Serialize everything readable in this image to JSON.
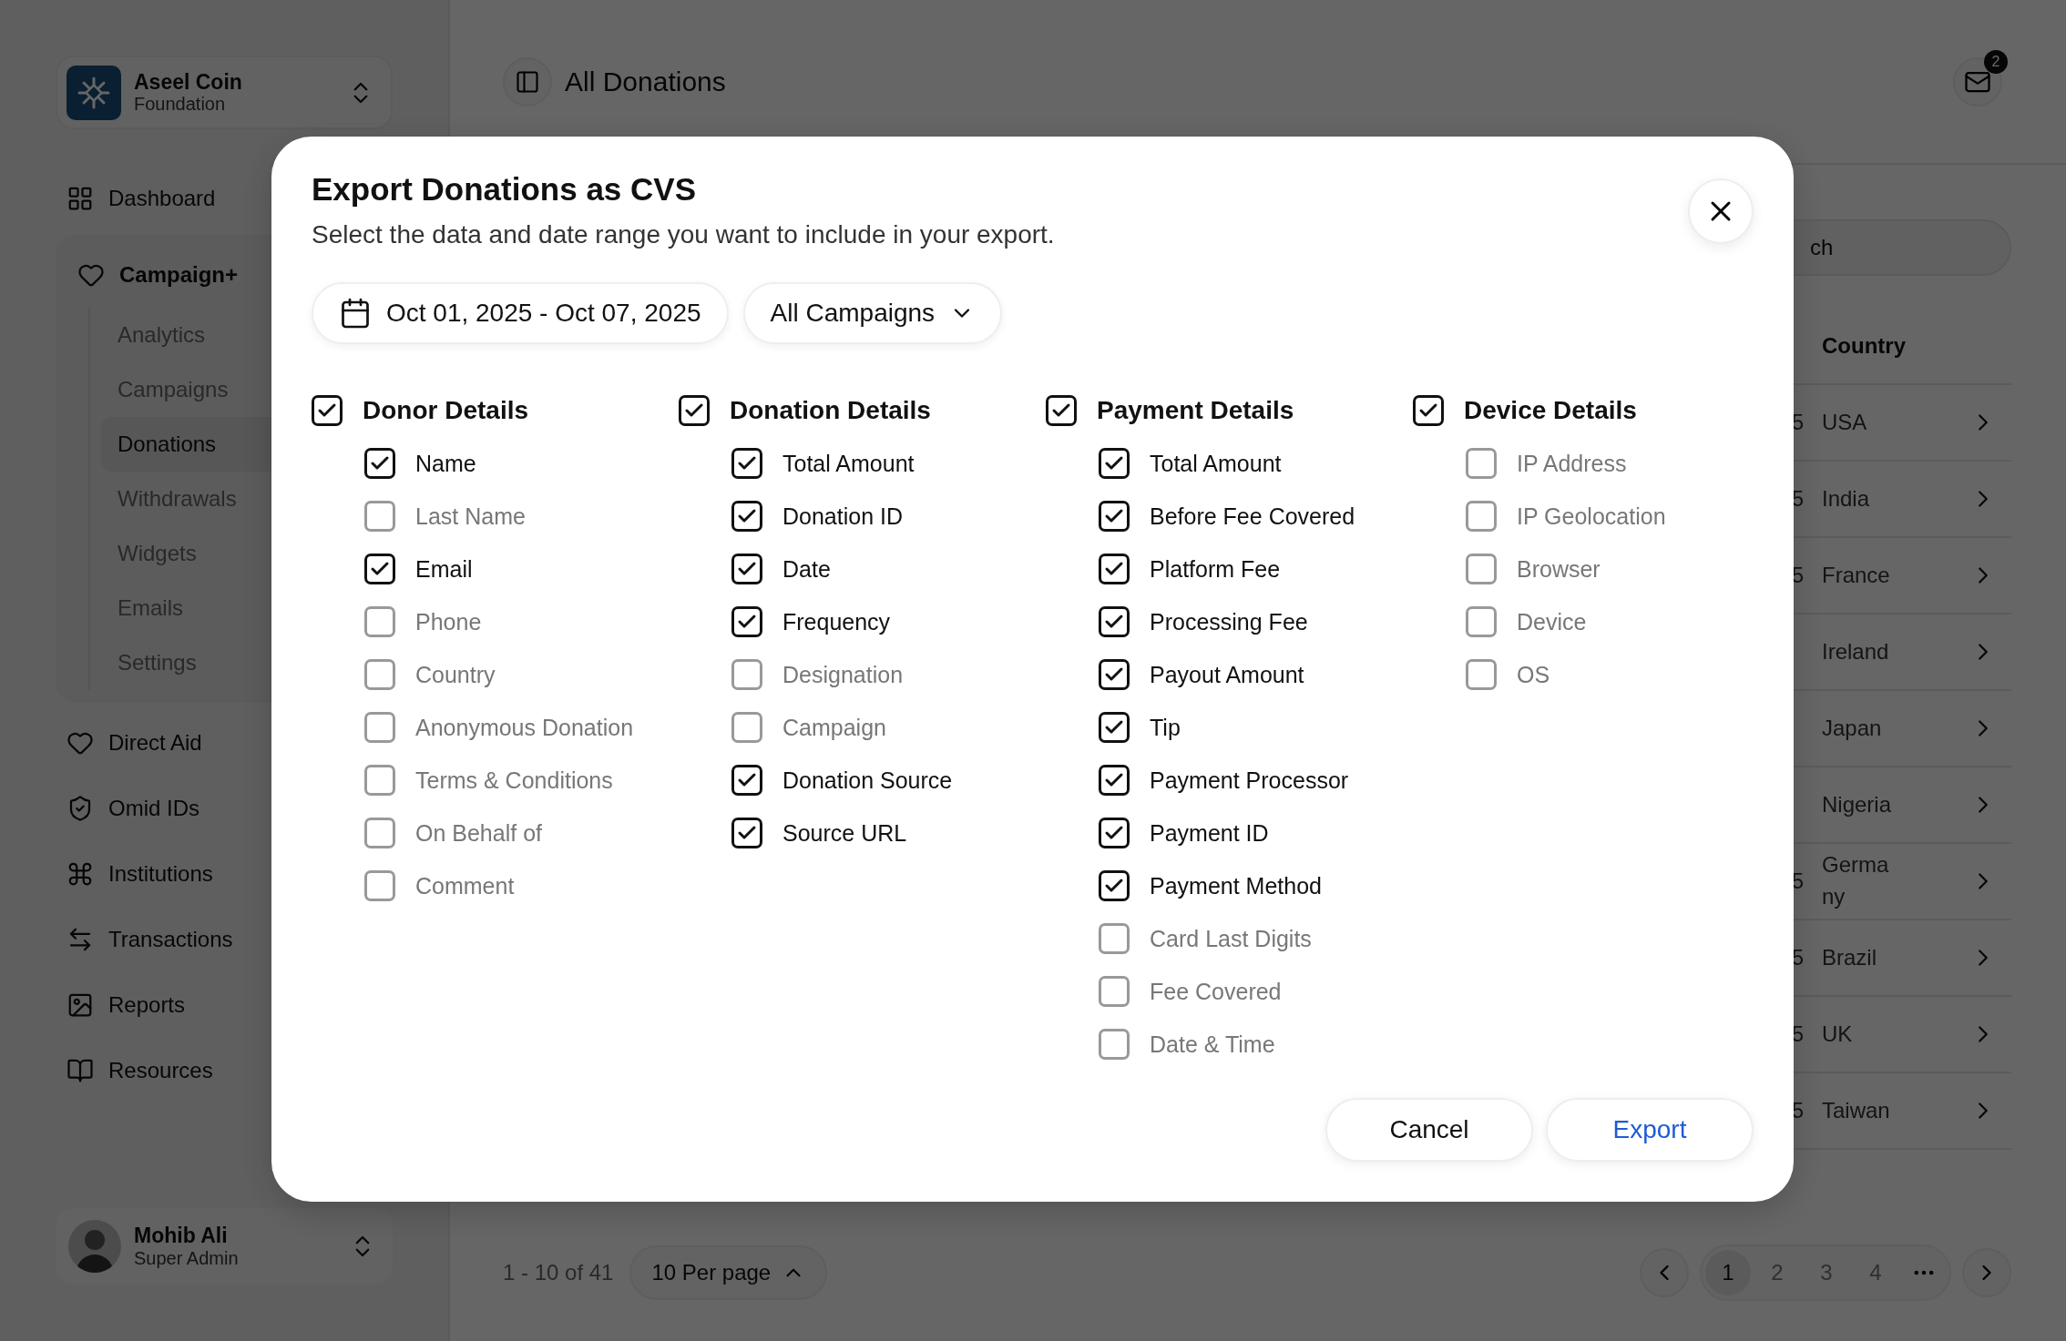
{
  "sidebar": {
    "org": {
      "name": "Aseel Coin",
      "subtitle": "Foundation"
    },
    "nav": [
      {
        "label": "Dashboard"
      },
      {
        "label": "Campaign+",
        "expanded": true,
        "children": [
          {
            "label": "Analytics",
            "selected": false
          },
          {
            "label": "Campaigns",
            "selected": false
          },
          {
            "label": "Donations",
            "selected": true
          },
          {
            "label": "Withdrawals",
            "selected": false
          },
          {
            "label": "Widgets",
            "selected": false
          },
          {
            "label": "Emails",
            "selected": false
          },
          {
            "label": "Settings",
            "selected": false
          }
        ]
      },
      {
        "label": "Direct Aid"
      },
      {
        "label": "Omid IDs"
      },
      {
        "label": "Institutions"
      },
      {
        "label": "Transactions"
      },
      {
        "label": "Reports"
      },
      {
        "label": "Resources"
      }
    ],
    "user": {
      "name": "Mohib Ali",
      "role": "Super Admin"
    }
  },
  "header": {
    "title": "All Donations",
    "notifications": "2"
  },
  "search": {
    "placeholder": "ch"
  },
  "table": {
    "columns": [
      {
        "label": "Country"
      }
    ],
    "rows": [
      {
        "column_1": "5",
        "country": "USA"
      },
      {
        "column_1": "5",
        "country": "India"
      },
      {
        "column_1": "5",
        "country": "France"
      },
      {
        "country": "Ireland"
      },
      {
        "country": "Japan"
      },
      {
        "country": "Nigeria"
      },
      {
        "column_1": "5",
        "country": "Germany"
      },
      {
        "column_1": "5",
        "country": "Brazil"
      },
      {
        "column_1": "5",
        "country": "UK"
      },
      {
        "column_1": "5",
        "country": "Taiwan"
      }
    ]
  },
  "pagination": {
    "range": "1 - 10 of 41",
    "per_page": "10 Per page",
    "pages": [
      {
        "label": "1",
        "selected": true
      },
      {
        "label": "2",
        "selected": false
      },
      {
        "label": "3",
        "selected": false
      },
      {
        "label": "4",
        "selected": false
      }
    ]
  },
  "modal": {
    "title": "Export Donations as CVS",
    "subtitle": "Select the data and date range you want to include in your export.",
    "date_range": "Oct 01, 2025 - Oct 07, 2025",
    "campaign_filter": "All Campaigns",
    "groups": [
      {
        "label": "Donor Details",
        "checked": true,
        "items": [
          {
            "label": "Name",
            "checked": true
          },
          {
            "label": "Last Name",
            "checked": false
          },
          {
            "label": "Email",
            "checked": true
          },
          {
            "label": "Phone",
            "checked": false
          },
          {
            "label": "Country",
            "checked": false
          },
          {
            "label": "Anonymous Donation",
            "checked": false
          },
          {
            "label": "Terms & Conditions",
            "checked": false
          },
          {
            "label": "On Behalf of",
            "checked": false
          },
          {
            "label": "Comment",
            "checked": false
          }
        ]
      },
      {
        "label": "Donation Details",
        "checked": true,
        "items": [
          {
            "label": "Total Amount",
            "checked": true
          },
          {
            "label": "Donation ID",
            "checked": true
          },
          {
            "label": "Date",
            "checked": true
          },
          {
            "label": "Frequency",
            "checked": true
          },
          {
            "label": "Designation",
            "checked": false
          },
          {
            "label": "Campaign",
            "checked": false
          },
          {
            "label": "Donation Source",
            "checked": true
          },
          {
            "label": "Source URL",
            "checked": true
          }
        ]
      },
      {
        "label": "Payment Details",
        "checked": true,
        "items": [
          {
            "label": "Total Amount",
            "checked": true
          },
          {
            "label": "Before Fee Covered",
            "checked": true
          },
          {
            "label": "Platform Fee",
            "checked": true
          },
          {
            "label": "Processing Fee",
            "checked": true
          },
          {
            "label": "Payout Amount",
            "checked": true
          },
          {
            "label": "Tip",
            "checked": true
          },
          {
            "label": "Payment Processor",
            "checked": true
          },
          {
            "label": "Payment ID",
            "checked": true
          },
          {
            "label": "Payment Method",
            "checked": true
          },
          {
            "label": "Card Last Digits",
            "checked": false
          },
          {
            "label": "Fee Covered",
            "checked": false
          },
          {
            "label": "Date & Time",
            "checked": false
          }
        ]
      },
      {
        "label": "Device Details",
        "checked": true,
        "items": [
          {
            "label": "IP Address",
            "checked": false
          },
          {
            "label": "IP Geolocation",
            "checked": false
          },
          {
            "label": "Browser",
            "checked": false
          },
          {
            "label": "Device",
            "checked": false
          },
          {
            "label": "OS",
            "checked": false
          }
        ]
      }
    ],
    "buttons": [
      {
        "label": "Cancel",
        "kind": "secondary"
      },
      {
        "label": "Export",
        "kind": "primary"
      }
    ]
  }
}
